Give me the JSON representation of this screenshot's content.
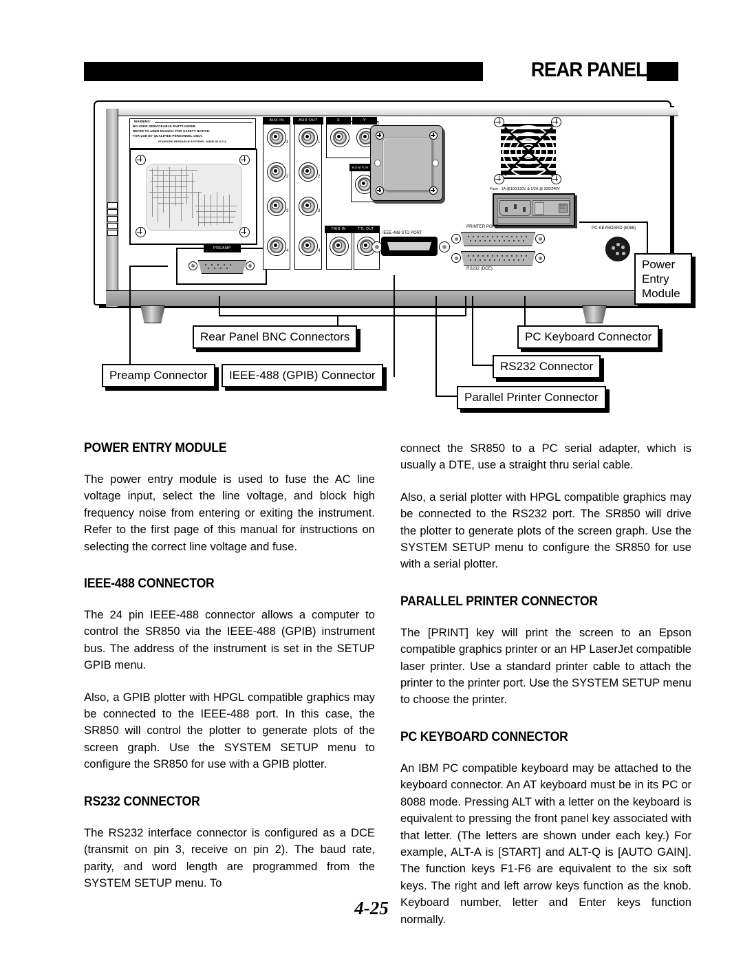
{
  "header": {
    "title": "REAR PANEL"
  },
  "page_number": "4-25",
  "diagram": {
    "warning_label": {
      "title": "WARNING:",
      "lines": [
        "NO USER SERVICEABLE PARTS INSIDE.",
        "REFER TO USER MANUAL FOR SAFETY NOTICE.",
        "FOR USE BY QUALIFIED PERSONNEL ONLY."
      ],
      "maker": "STANFORD RESEARCH SYSTEMS - MADE IN U.S.A."
    },
    "panel_labels": {
      "preamp": "PREAMP",
      "aux_in": "AUX IN",
      "aux_out": "AUX OUT",
      "x": "X",
      "y": "Y",
      "monitor_out": "MONITOR OUT",
      "trig_in": "TRIG IN",
      "ttl_out": "TTL OUT",
      "ieee488_port": "IEEE-488 STD PORT",
      "printer_port": "PRINTER PORT",
      "rs232_port": "RS232 (DCE)",
      "pc_keyboard": "PC KEYBOARD (8088)",
      "fuse": "Fuse : 1A @100/120V & 1/2A @ 220/240V"
    },
    "bnc_numbers": [
      "1",
      "2",
      "3",
      "4"
    ],
    "callouts": {
      "bnc": "Rear Panel BNC Connectors",
      "preamp": "Preamp Connector",
      "gpib": "IEEE-488 (GPIB) Connector",
      "keyboard": "PC Keyboard Connector",
      "rs232": "RS232 Connector",
      "printer": "Parallel Printer Connector",
      "power_entry": "Power Entry Module"
    }
  },
  "sections": {
    "power_entry": {
      "heading": "POWER ENTRY MODULE",
      "paragraphs": [
        "The power entry module is used to fuse the AC line voltage input, select the line voltage, and block high frequency noise from entering or exiting the instrument. Refer to the first page of this manual for instructions on selecting the correct line voltage and fuse."
      ]
    },
    "ieee488": {
      "heading": "IEEE-488 CONNECTOR",
      "paragraphs": [
        "The 24 pin IEEE-488 connector allows a computer to control the SR850 via the IEEE-488 (GPIB) instrument bus. The address of the instrument is set in the SETUP GPIB menu.",
        "Also, a GPIB plotter with HPGL compatible graphics may be connected to the IEEE-488 port. In this case, the SR850 will control the plotter to generate plots of the screen graph. Use the SYSTEM SETUP menu to configure the SR850 for use with a GPIB plotter."
      ]
    },
    "rs232": {
      "heading": "RS232 CONNECTOR",
      "paragraphs": [
        "The RS232 interface connector is configured as a DCE (transmit on pin 3, receive on pin 2). The baud rate, parity, and word length are programmed from the SYSTEM SETUP menu. To"
      ]
    },
    "rs232_cont": {
      "paragraphs": [
        "connect the SR850 to a PC serial adapter, which is usually a DTE, use a straight thru serial cable.",
        "Also, a serial plotter with HPGL compatible graphics may be connected to the RS232 port. The SR850 will drive the plotter to generate plots of the screen graph. Use the SYSTEM SETUP menu to configure the SR850 for use with a serial plotter."
      ]
    },
    "parallel_printer": {
      "heading": "PARALLEL PRINTER CONNECTOR",
      "paragraphs": [
        "The [PRINT] key will print the screen to an Epson compatible graphics printer or an HP LaserJet compatible laser printer. Use a standard printer cable to attach the printer to the printer port. Use the SYSTEM SETUP menu to choose the printer."
      ]
    },
    "pc_keyboard": {
      "heading": "PC KEYBOARD CONNECTOR",
      "paragraphs": [
        "An IBM PC compatible keyboard may be attached to the keyboard connector. An AT keyboard must be in its PC or 8088 mode. Pressing ALT with a letter on the keyboard is equivalent to pressing the front panel key associated with that letter. (The letters are shown under each key.) For example, ALT-A is [START] and ALT-Q is [AUTO GAIN]. The function keys F1-F6 are equivalent to the six soft keys. The right and left arrow keys function as the knob. Keyboard number, letter and Enter keys function normally."
      ]
    }
  }
}
